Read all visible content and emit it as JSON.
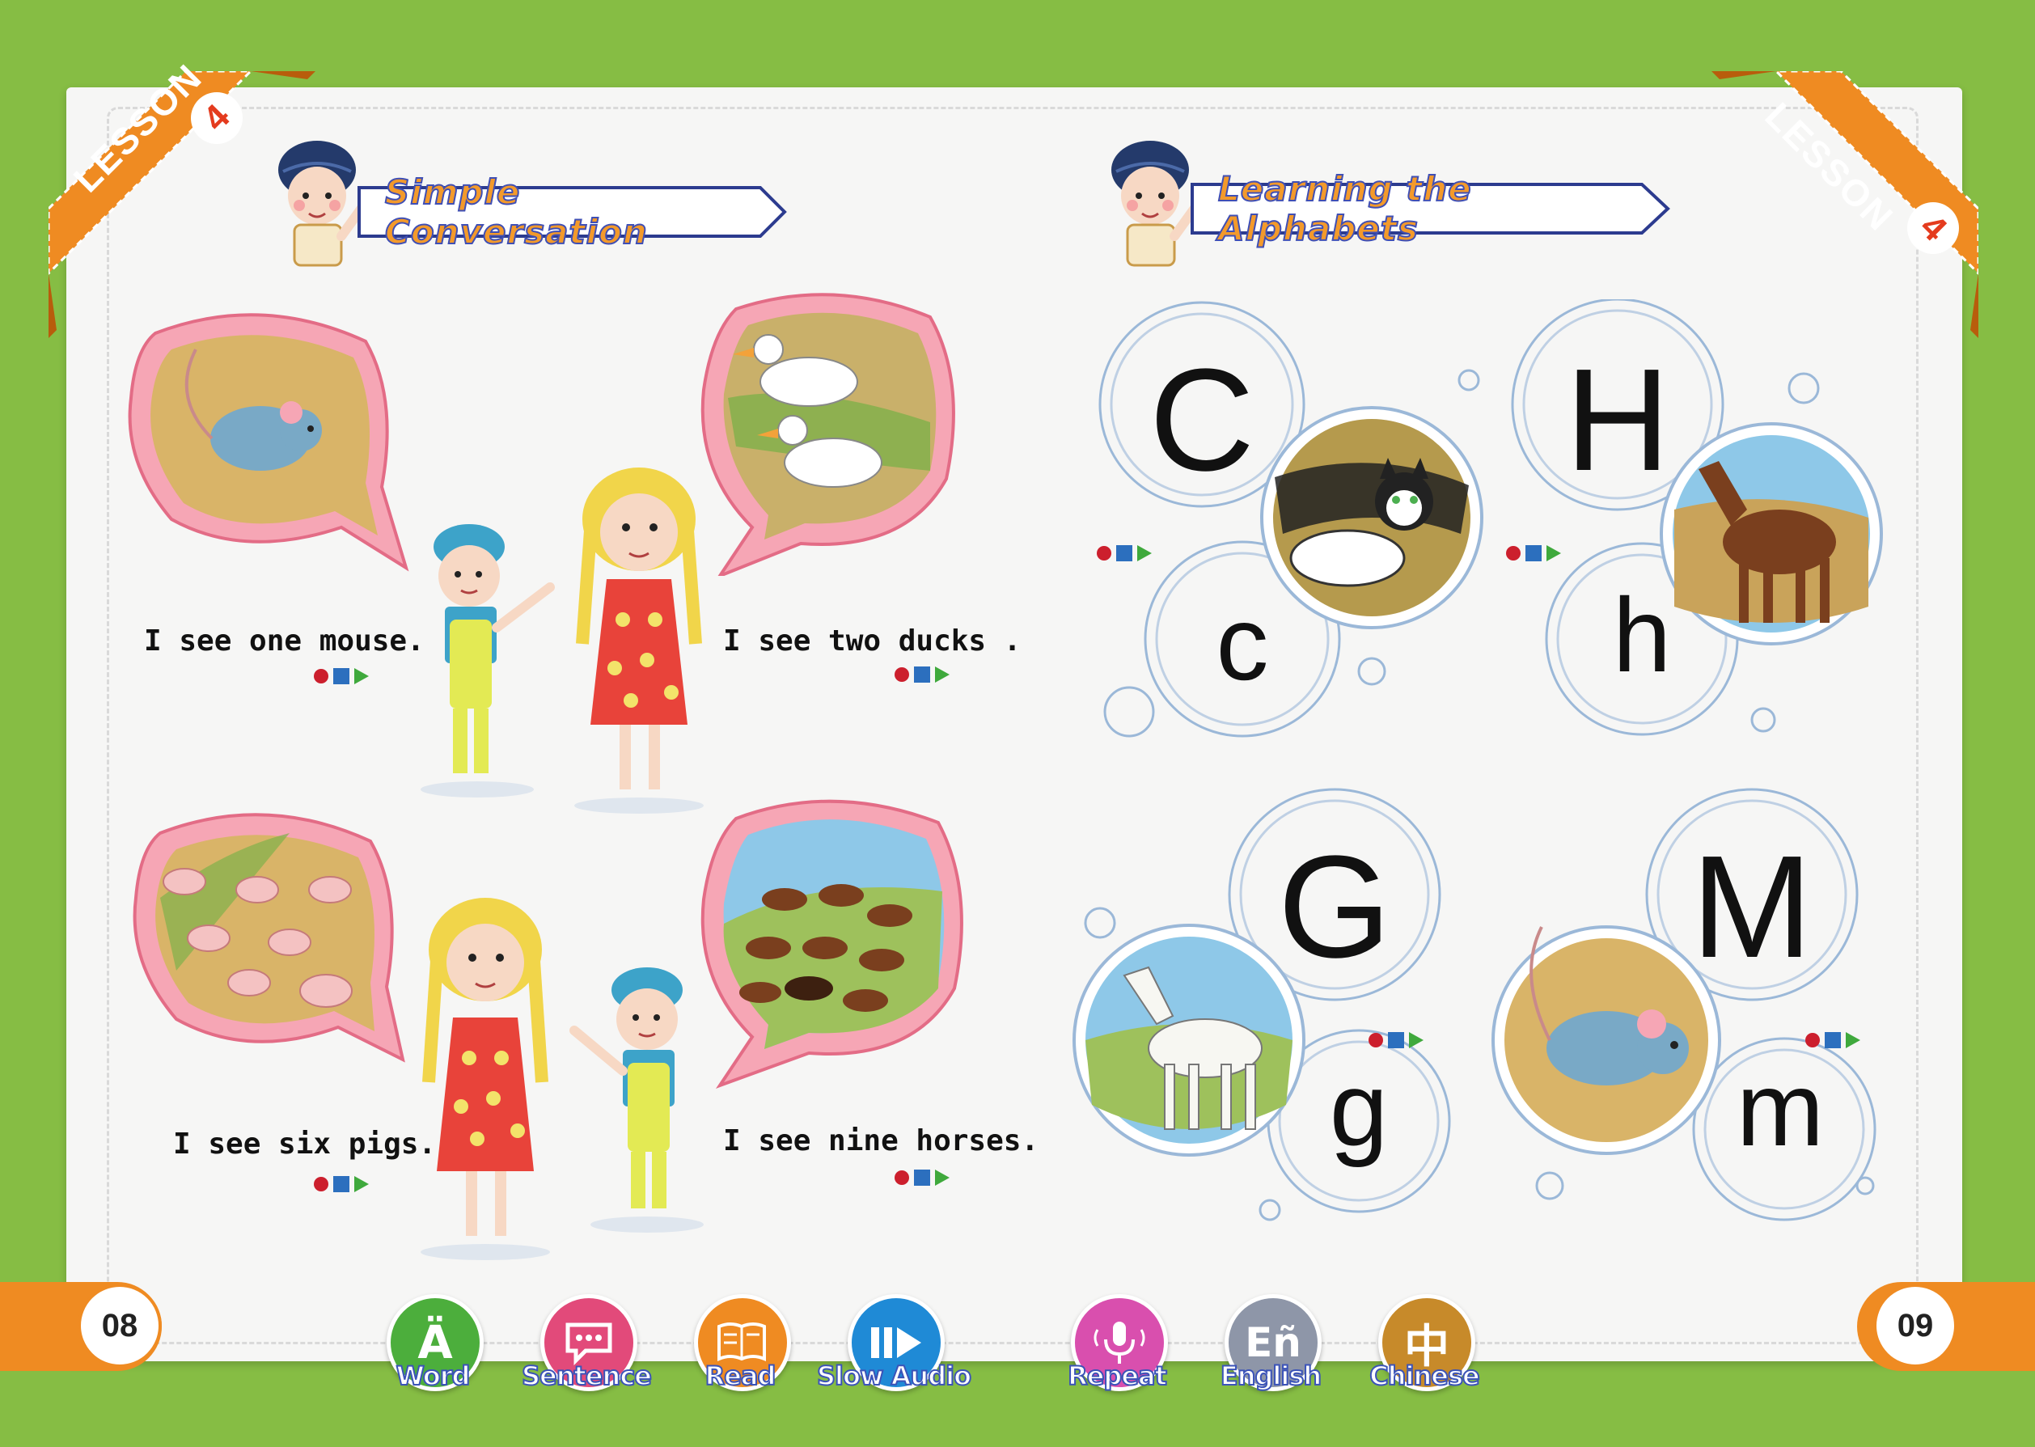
{
  "colors": {
    "background": "#86bd44",
    "page": "#f6f6f5",
    "banner": "#ef8b22",
    "title_fill": "#f39a2b",
    "title_stroke": "#3f4fb5"
  },
  "left_page": {
    "lesson_banner": {
      "label": "LESSON",
      "number": "4"
    },
    "section_title": "Simple Conversation",
    "sentences": [
      {
        "text": "I see one mouse.",
        "picture": "mouse-icon"
      },
      {
        "text": "I see two ducks .",
        "picture": "ducks-icon"
      },
      {
        "text": "I see six pigs.",
        "picture": "pigs-icon"
      },
      {
        "text": "I see nine horses.",
        "picture": "horses-icon"
      }
    ],
    "page_number": "08"
  },
  "right_page": {
    "lesson_banner": {
      "label": "LESSON",
      "number": "4"
    },
    "section_title": "Learning the Alphabets",
    "letters": [
      {
        "upper": "C",
        "lower": "c",
        "picture": "cat-icon"
      },
      {
        "upper": "H",
        "lower": "h",
        "picture": "horse-icon"
      },
      {
        "upper": "G",
        "lower": "g",
        "picture": "goat-icon"
      },
      {
        "upper": "M",
        "lower": "m",
        "picture": "mouse-icon"
      }
    ],
    "page_number": "09"
  },
  "toolbar": {
    "word": {
      "label": "Word",
      "glyph": "Ä",
      "color": "#4cae3c"
    },
    "sentence": {
      "label": "Sentence",
      "glyph": "💬",
      "color": "#e24a7a"
    },
    "read": {
      "label": "Read",
      "glyph": "📖",
      "color": "#ef8b22"
    },
    "slow_audio": {
      "label": "Slow Audio",
      "glyph": "▮▮▶",
      "color": "#1f8ad6"
    },
    "repeat": {
      "label": "Repeat",
      "glyph": "🎙",
      "color": "#d94fae"
    },
    "english": {
      "label": "English",
      "glyph": "Eñ",
      "color": "#8e96a8"
    },
    "chinese": {
      "label": "Chinese",
      "glyph": "中",
      "color": "#c78a2a"
    }
  }
}
